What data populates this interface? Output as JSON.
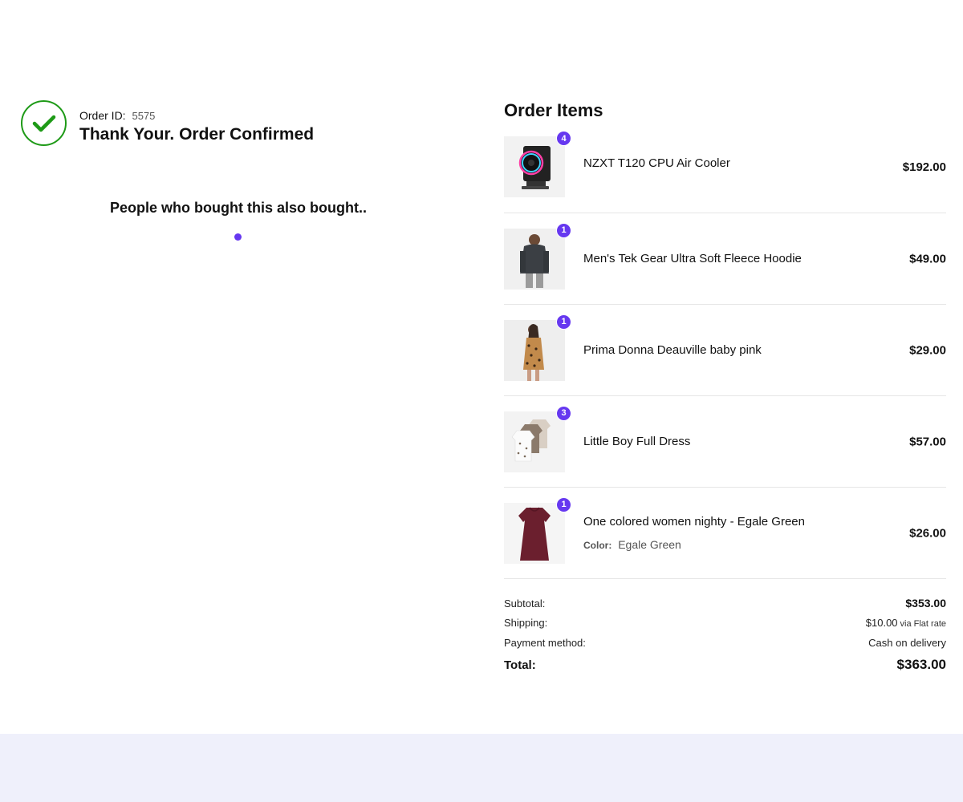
{
  "confirmation": {
    "order_id_label": "Order ID:",
    "order_id_value": "5575",
    "title": "Thank Your. Order Confirmed",
    "check_icon": "check-circle-icon",
    "accent_color": "#1e9a17"
  },
  "recommendations": {
    "heading": "People who bought this also bought..",
    "loader_color": "#6638f0"
  },
  "order_items": {
    "title": "Order Items",
    "badge_color": "#6638f0",
    "items": [
      {
        "name": "NZXT T120 CPU Air Cooler",
        "qty": "4",
        "price": "$192.00",
        "image": "cpu-cooler-image"
      },
      {
        "name": "Men's Tek Gear Ultra Soft Fleece Hoodie",
        "qty": "1",
        "price": "$49.00",
        "image": "hoodie-image"
      },
      {
        "name": "Prima Donna Deauville baby pink",
        "qty": "1",
        "price": "$29.00",
        "image": "leopard-dress-image"
      },
      {
        "name": "Little Boy Full Dress",
        "qty": "3",
        "price": "$57.00",
        "image": "baby-bodysuits-image"
      },
      {
        "name": "One colored women nighty - Egale Green",
        "qty": "1",
        "price": "$26.00",
        "image": "nighty-image",
        "meta_label": "Color:",
        "meta_value": "Egale Green"
      }
    ]
  },
  "totals": {
    "subtotal_label": "Subtotal:",
    "subtotal_value": "$353.00",
    "shipping_label": "Shipping:",
    "shipping_value": "$10.00",
    "shipping_via": "via Flat rate",
    "payment_label": "Payment method:",
    "payment_value": "Cash on delivery",
    "total_label": "Total:",
    "total_value": "$363.00"
  }
}
